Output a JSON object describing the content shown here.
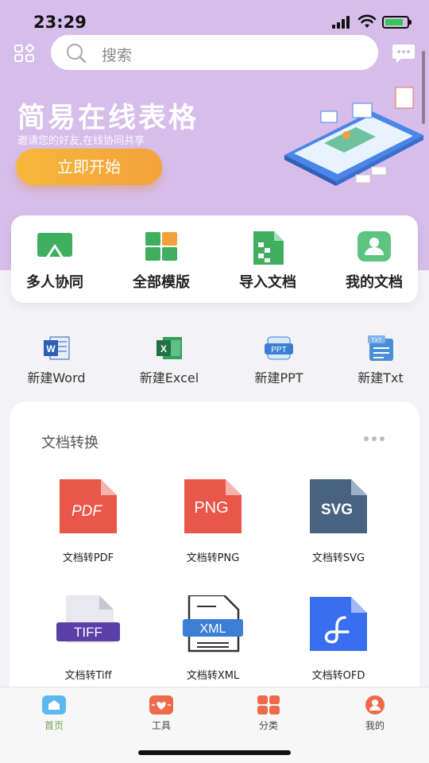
{
  "status": {
    "time": "23:29"
  },
  "search": {
    "placeholder": "搜索"
  },
  "banner": {
    "title": "简易在线表格",
    "subtitle": "邀请您的好友,在线协同共享",
    "button_label": "立即开始"
  },
  "quick_actions": [
    {
      "label": "多人协同",
      "icon": "screen-share-icon",
      "color": "#3fae5f"
    },
    {
      "label": "全部模版",
      "icon": "template-grid-icon",
      "color": "#3fae5f"
    },
    {
      "label": "导入文档",
      "icon": "import-sheet-icon",
      "color": "#3fae5f"
    },
    {
      "label": "我的文档",
      "icon": "user-doc-icon",
      "color": "#5cc47f"
    }
  ],
  "new_docs": [
    {
      "label": "新建Word",
      "icon": "word-icon",
      "color": "#2b5fb4"
    },
    {
      "label": "新建Excel",
      "icon": "excel-icon",
      "color": "#207245"
    },
    {
      "label": "新建PPT",
      "icon": "ppt-icon",
      "color": "#3a7fd5"
    },
    {
      "label": "新建Txt",
      "icon": "txt-icon",
      "color": "#4a8fd6"
    }
  ],
  "conversion": {
    "title": "文档转换",
    "items": [
      {
        "label": "文档转PDF",
        "badge": "PDF",
        "color": "#e8574a"
      },
      {
        "label": "文档转PNG",
        "badge": "PNG",
        "color": "#e8574a"
      },
      {
        "label": "文档转SVG",
        "badge": "SVG",
        "color": "#4a6282"
      },
      {
        "label": "文档转Tiff",
        "badge": "TIFF",
        "color": "#5b3fa8"
      },
      {
        "label": "文档转XML",
        "badge": "XML",
        "color": "#3a7fd5"
      },
      {
        "label": "文档转OFD",
        "badge": "",
        "color": "#3a6ef0"
      }
    ]
  },
  "tabs": [
    {
      "label": "首页",
      "active": true,
      "color": "#5cb8f0"
    },
    {
      "label": "工具",
      "active": false,
      "color": "#ee6a4a"
    },
    {
      "label": "分类",
      "active": false,
      "color": "#ee6a4a"
    },
    {
      "label": "我的",
      "active": false,
      "color": "#ee6a4a"
    }
  ],
  "colors": {
    "accent": "#d7bdea",
    "tab_active": "#6fa35a"
  }
}
